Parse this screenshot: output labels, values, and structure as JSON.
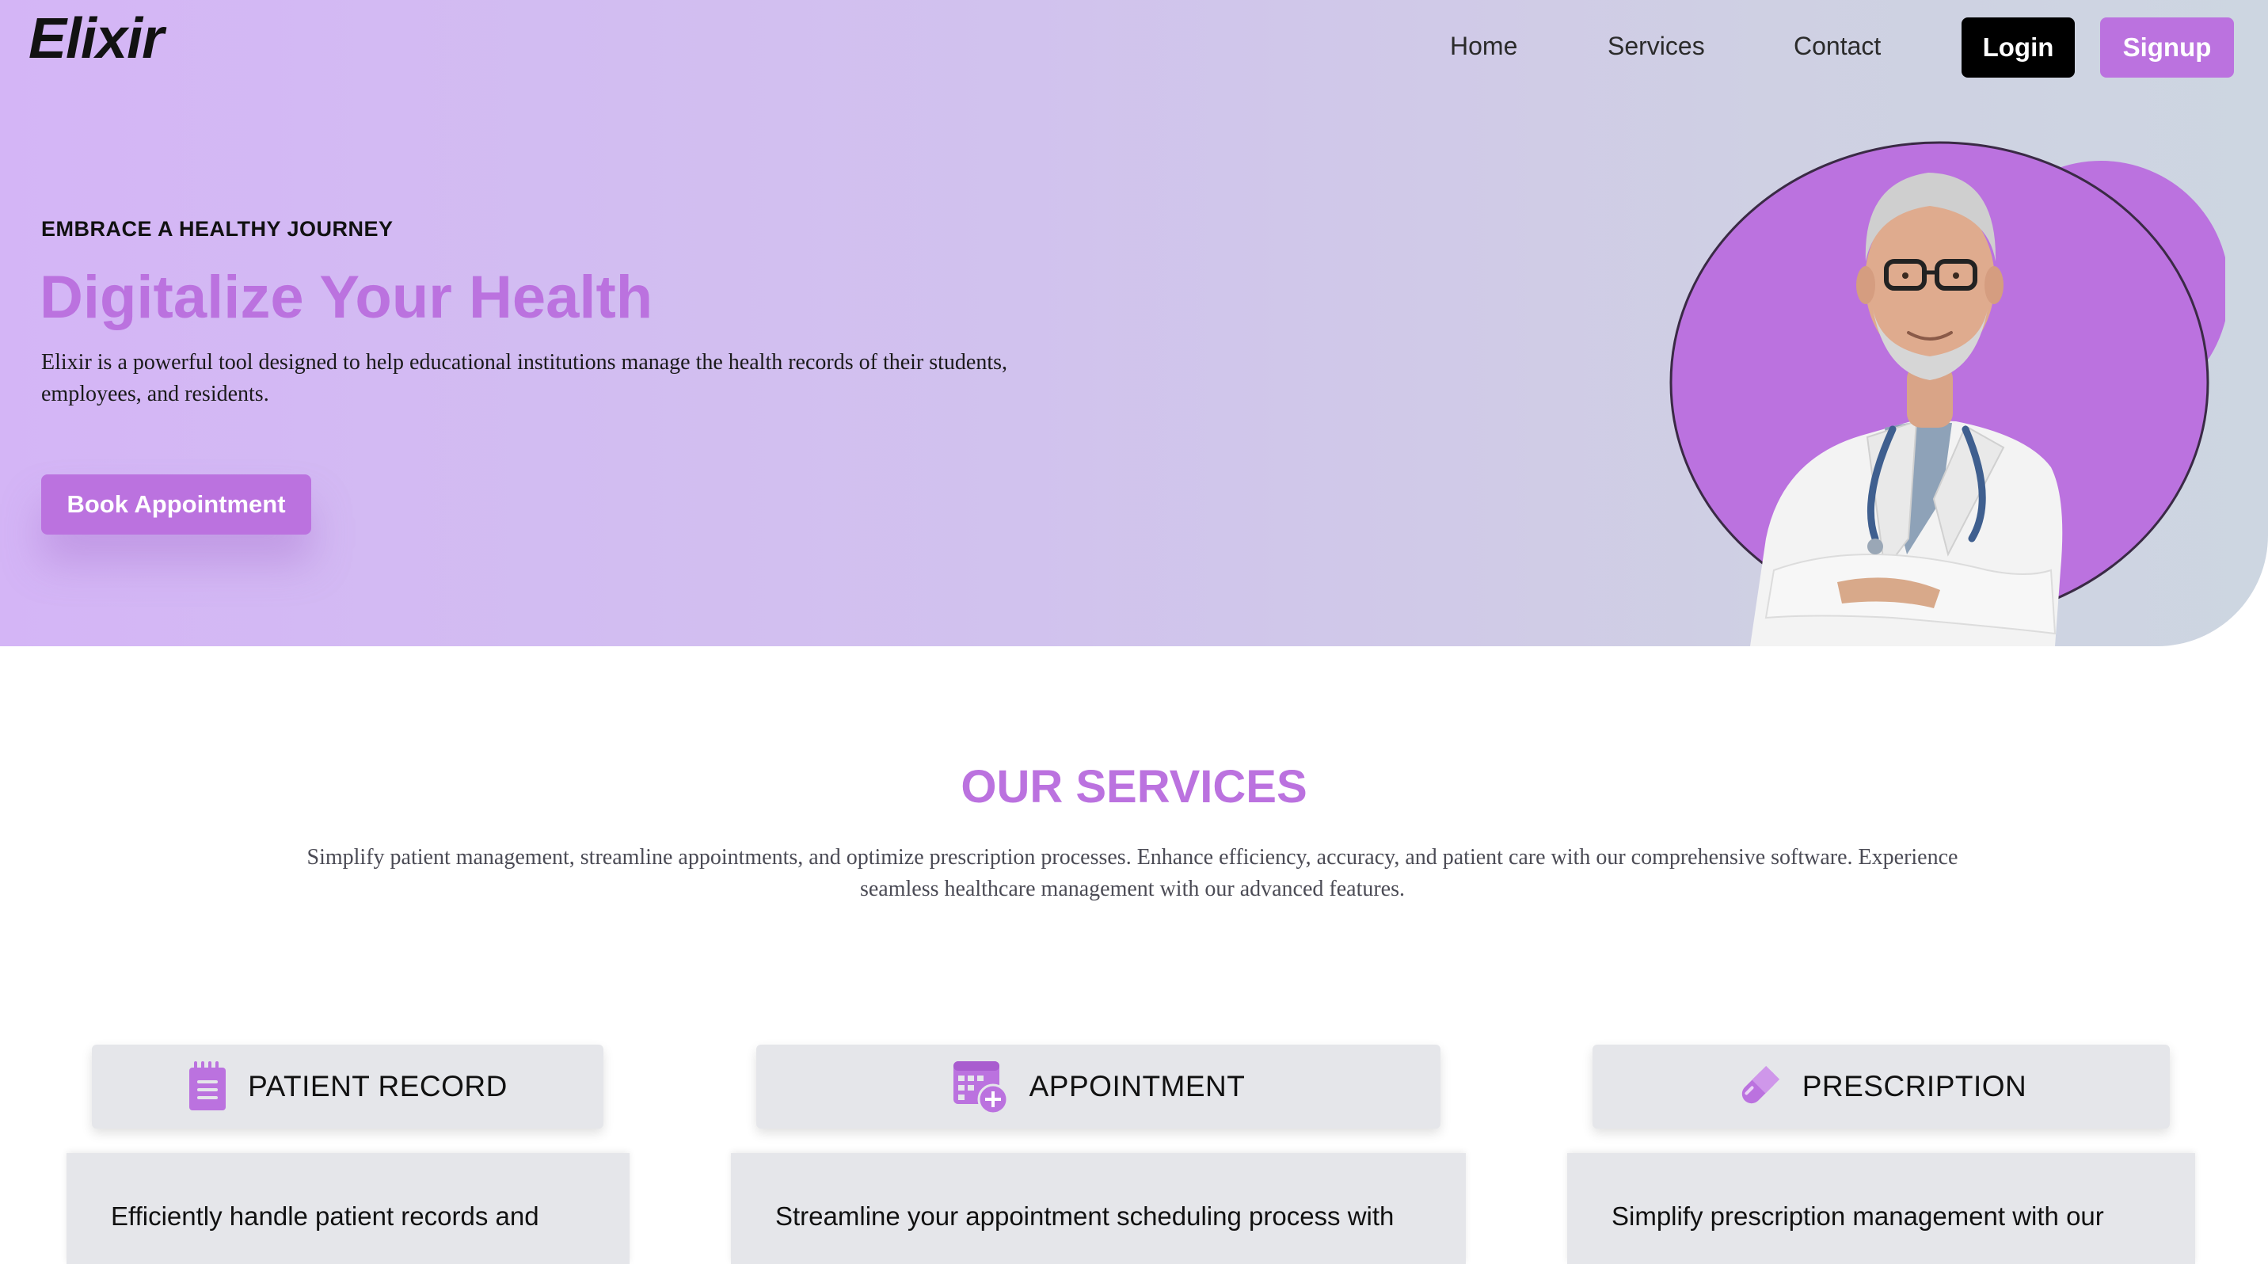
{
  "header": {
    "brand": "Elixir",
    "nav": {
      "home": "Home",
      "services": "Services",
      "contact": "Contact"
    },
    "login_label": "Login",
    "signup_label": "Signup"
  },
  "hero": {
    "eyebrow": "EMBRACE A HEALTHY JOURNEY",
    "title": "Digitalize Your Health",
    "description": "Elixir is a powerful tool designed to help educational institutions manage the health records of their students, employees, and residents.",
    "cta_label": "Book Appointment",
    "image": "doctor-portrait"
  },
  "services": {
    "title": "OUR SERVICES",
    "description": "Simplify patient management, streamline appointments, and optimize prescription processes. Enhance efficiency, accuracy, and patient care with our comprehensive software. Experience seamless healthcare management with our advanced features.",
    "cards": [
      {
        "icon": "notepad-icon",
        "label": "PATIENT RECORD",
        "body": "Efficiently handle patient records and"
      },
      {
        "icon": "calendar-plus-icon",
        "label": "APPOINTMENT",
        "body": "Streamline your appointment scheduling process with"
      },
      {
        "icon": "pill-icon",
        "label": "PRESCRIPTION",
        "body": "Simplify prescription management with our"
      }
    ]
  },
  "colors": {
    "accent": "#bb72df",
    "hero_gradient_start": "#d4b5f6",
    "hero_gradient_end": "#cdd6e1",
    "card_bg": "#e5e6ea",
    "login_bg": "#000000"
  }
}
